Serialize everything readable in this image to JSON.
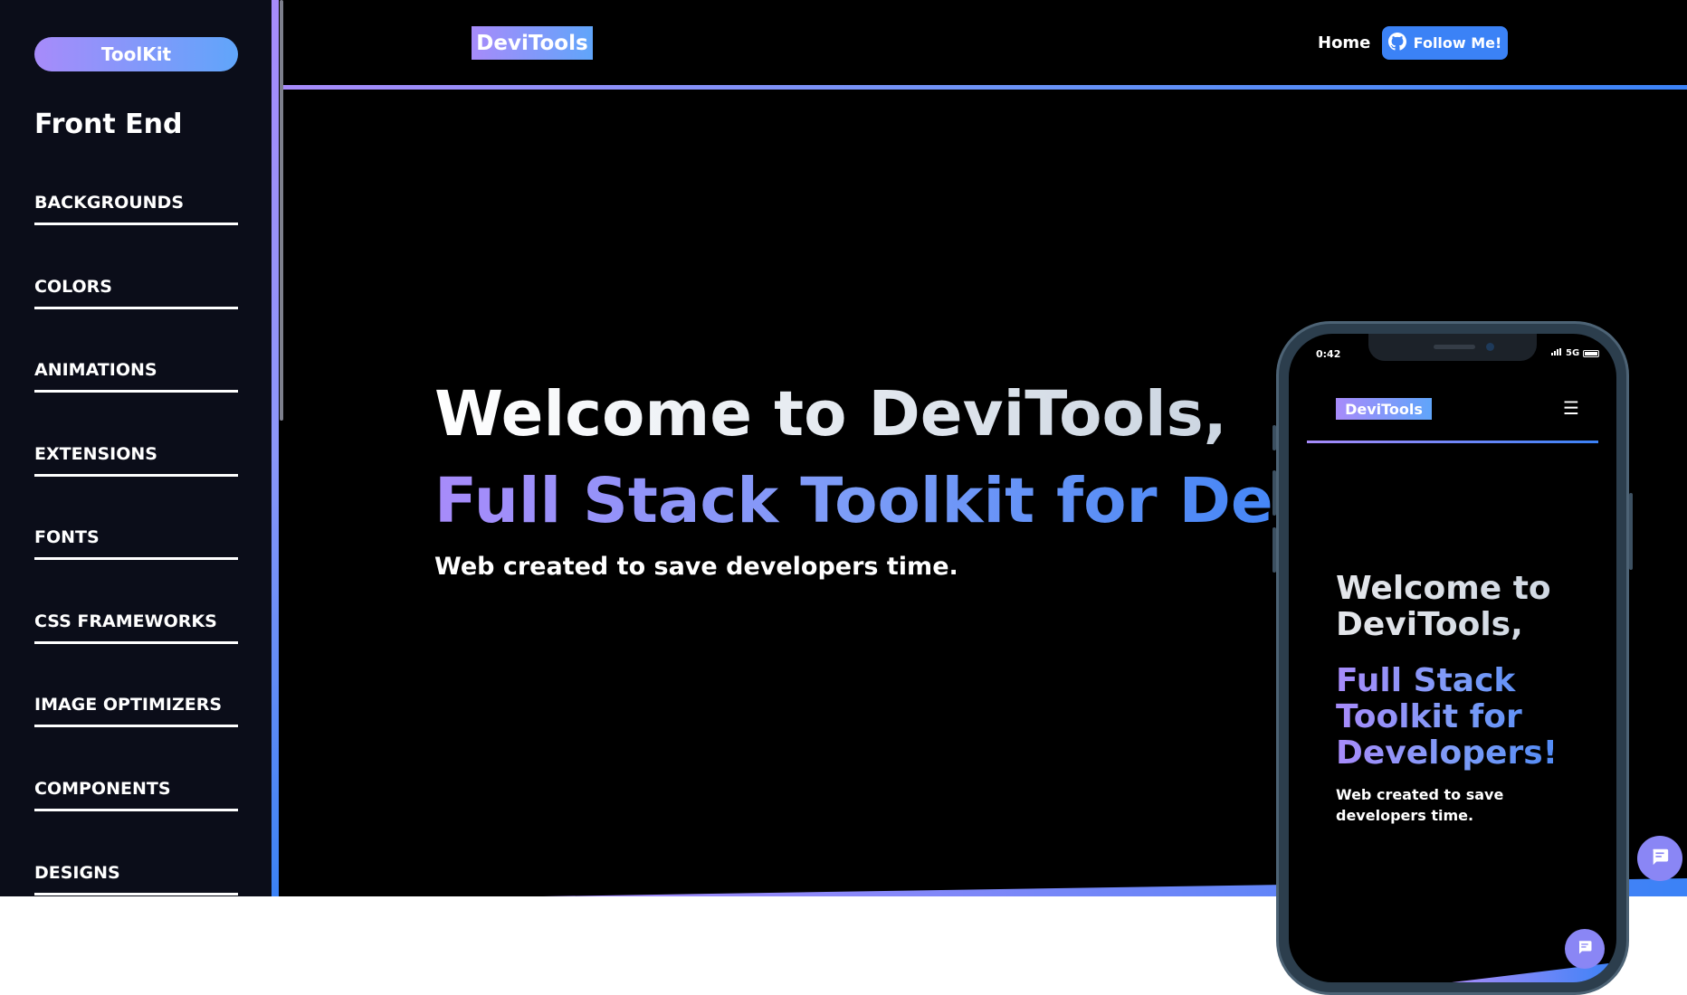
{
  "sidebar": {
    "toolkit_label": "ToolKit",
    "heading": "Front End",
    "items": [
      {
        "label": "BACKGROUNDS"
      },
      {
        "label": "COLORS"
      },
      {
        "label": "ANIMATIONS"
      },
      {
        "label": "EXTENSIONS"
      },
      {
        "label": "FONTS"
      },
      {
        "label": "CSS FRAMEWORKS"
      },
      {
        "label": "IMAGE OPTIMIZERS"
      },
      {
        "label": "COMPONENTS"
      },
      {
        "label": "DESIGNS"
      }
    ]
  },
  "header": {
    "logo": "DeviTools",
    "nav_home": "Home",
    "follow_label": "Follow Me!",
    "follow_icon": "github-icon"
  },
  "hero": {
    "title_line1": "Welcome to DeviTools,",
    "title_line2": "Full Stack Toolkit for Deve",
    "subtitle": "Web created to save developers time."
  },
  "phone": {
    "status_time": "0:42",
    "status_network": "5G",
    "logo": "DeviTools",
    "menu_icon": "hamburger-icon",
    "title_line1": "Welcome to DeviTools,",
    "title_line2": "Full Stack Toolkit for Developers!",
    "subtitle": "Web created to save developers time."
  },
  "colors": {
    "gradient_start": "#a78bfa",
    "gradient_end": "#3b82f6",
    "background": "#000000",
    "sidebar_bg": "#0b0d19",
    "chat_button": "#8a86f5"
  }
}
